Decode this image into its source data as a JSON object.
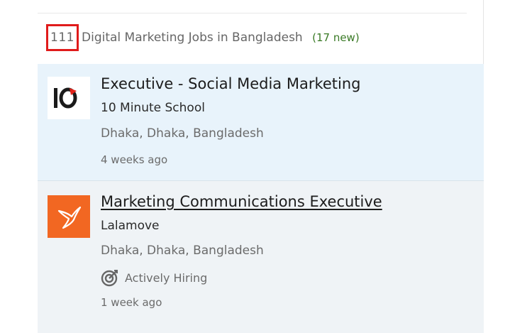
{
  "results": {
    "count": "111",
    "query_text": "Digital Marketing Jobs in Bangladesh",
    "new_count": "(17 new)"
  },
  "jobs": [
    {
      "title": "Executive - Social Media Marketing",
      "company": "10 Minute School",
      "location": "Dhaka, Dhaka, Bangladesh",
      "posted": "4 weeks ago",
      "logo_icon": "10-minute-school-logo"
    },
    {
      "title": "Marketing Communications Executive",
      "company": "Lalamove",
      "location": "Dhaka, Dhaka, Bangladesh",
      "badge": "Actively Hiring",
      "posted": "1 week ago",
      "logo_icon": "lalamove-hummingbird-logo"
    }
  ],
  "colors": {
    "highlight_box": "#e01b1b",
    "new_count": "#3a7a26",
    "selected_card_bg": "#e8f3fb",
    "card_bg": "#eff3f6",
    "lalamove_brand": "#f26722"
  }
}
